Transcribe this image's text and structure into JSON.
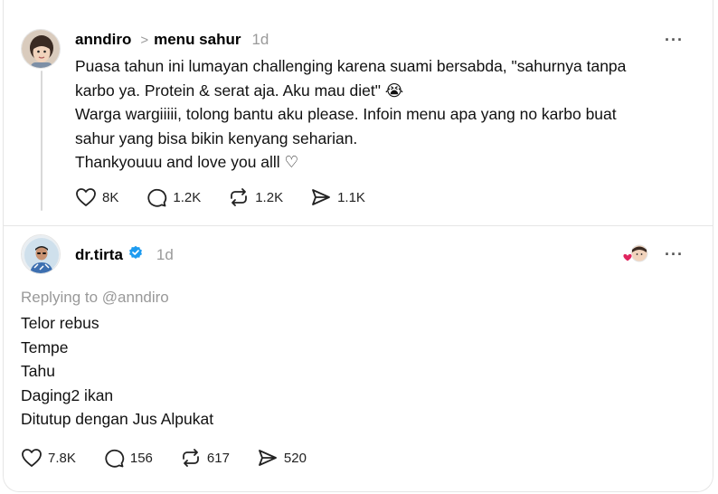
{
  "post": {
    "username": "anndiro",
    "separator": ">",
    "topic": "menu sahur",
    "time": "1d",
    "more": "···",
    "lines": [
      "Puasa tahun ini lumayan challenging karena suami bersabda, \"sahurnya tanpa",
      "karbo ya. Protein & serat aja. Aku mau diet\" 😭",
      "Warga wargiiiii, tolong bantu aku please. Infoin menu apa yang no karbo buat",
      "sahur yang bisa bikin kenyang seharian.",
      "Thankyouuu and love you alll ♡"
    ],
    "stats": {
      "likes": "8K",
      "replies": "1.2K",
      "reposts": "1.2K",
      "shares": "1.1K"
    }
  },
  "reply": {
    "username": "dr.tirta",
    "time": "1d",
    "more": "···",
    "replying_to": "Replying to @anndiro",
    "lines": [
      "Telor rebus",
      "Tempe",
      "Tahu",
      "Daging2 ikan",
      "Ditutup dengan Jus Alpukat"
    ],
    "stats": {
      "likes": "7.8K",
      "replies": "156",
      "reposts": "617",
      "shares": "520"
    }
  },
  "icons": {
    "like": "heart-icon",
    "reply": "comment-icon",
    "repost": "repost-icon",
    "share": "send-icon",
    "verified": "verified-badge-icon",
    "liked_by_author": "author-liked-heart-icon"
  },
  "colors": {
    "verified": "#1d9bf0",
    "liked_heart": "#e0245e",
    "muted": "#999999",
    "divider": "#e6e6e6"
  }
}
